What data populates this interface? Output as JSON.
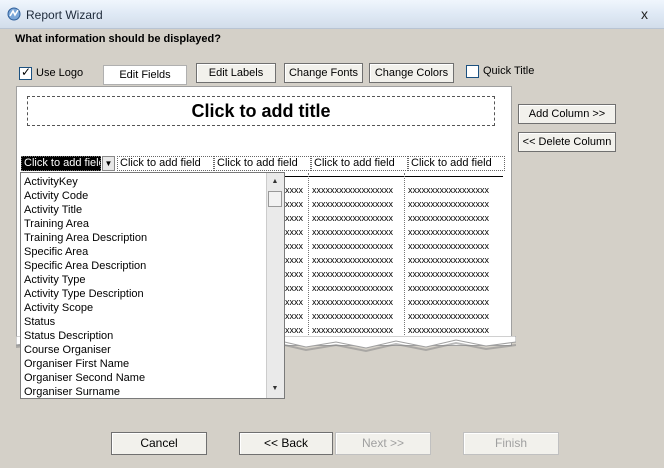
{
  "window": {
    "title": "Report Wizard",
    "close_glyph": "x",
    "icon": "report-wizard-icon"
  },
  "prompt": "What information should be displayed?",
  "options": {
    "use_logo": {
      "label": "Use Logo",
      "checked": true
    },
    "quick_title": {
      "label": "Quick Title",
      "checked": false
    }
  },
  "toolbar": {
    "edit_fields": "Edit Fields",
    "edit_labels": "Edit Labels",
    "change_fonts": "Change Fonts",
    "change_colors": "Change Colors"
  },
  "side": {
    "add_column": "Add Column >>",
    "delete_column": "<< Delete Column"
  },
  "report": {
    "title_placeholder": "Click to add title",
    "field_headers": [
      "Click to add field",
      "Click to add field",
      "Click to add field",
      "Click to add field",
      "Click to add field"
    ],
    "row_fill_short": "xxxx",
    "row_fill_long": "xxxxxxxxxxxxxxxxxx",
    "row_count": 11
  },
  "field_list": {
    "items": [
      "ActivityKey",
      "Activity Code",
      "Activity Title",
      "Training Area",
      "Training Area Description",
      "Specific Area",
      "Specific Area Description",
      "Activity Type",
      "Activity Type Description",
      "Activity Scope",
      "Status",
      "Status Description",
      "Course Organiser",
      "Organiser First Name",
      "Organiser Second Name",
      "Organiser Surname"
    ],
    "scroll_up": "▲",
    "scroll_down": "▼"
  },
  "footer": {
    "cancel": "Cancel",
    "back": "<< Back",
    "next": "Next >>",
    "finish": "Finish"
  }
}
